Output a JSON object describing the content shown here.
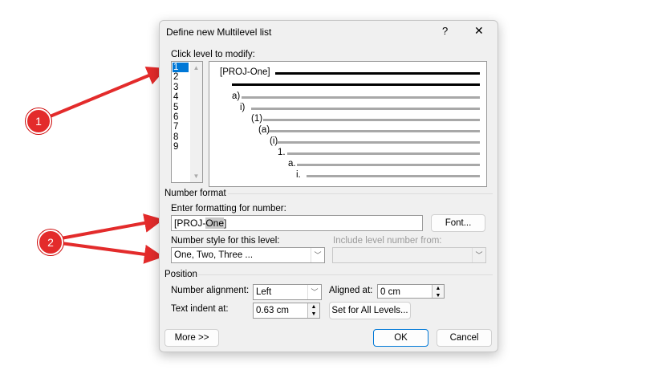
{
  "dialog": {
    "title": "Define new Multilevel list",
    "help": "?",
    "close": "✕"
  },
  "levels": {
    "label": "Click level to modify:",
    "items": [
      "1",
      "2",
      "3",
      "4",
      "5",
      "6",
      "7",
      "8",
      "9"
    ],
    "selected": "1"
  },
  "preview": {
    "first": "[PROJ-One]",
    "labels": [
      "a)",
      "i)",
      "(1)",
      "(a)",
      "(i)",
      "1.",
      "a.",
      "i."
    ]
  },
  "number_format": {
    "section": "Number format",
    "enter_label": "Enter formatting for number:",
    "value_plain": "[PROJ-",
    "value_selected": "One",
    "value_end": "]",
    "font_button": "Font...",
    "style_label": "Number style for this level:",
    "style_value": "One, Two, Three ...",
    "include_label": "Include level number from:",
    "include_value": ""
  },
  "position": {
    "section": "Position",
    "alignment_label": "Number alignment:",
    "alignment_value": "Left",
    "aligned_at_label": "Aligned at:",
    "aligned_at_value": "0 cm",
    "indent_label": "Text indent at:",
    "indent_value": "0.63 cm",
    "set_all": "Set for All Levels..."
  },
  "footer": {
    "more": "More >>",
    "ok": "OK",
    "cancel": "Cancel"
  },
  "annotations": [
    "1",
    "2"
  ],
  "colors": {
    "accent": "#0078d7",
    "annotation": "#e32b2b"
  }
}
